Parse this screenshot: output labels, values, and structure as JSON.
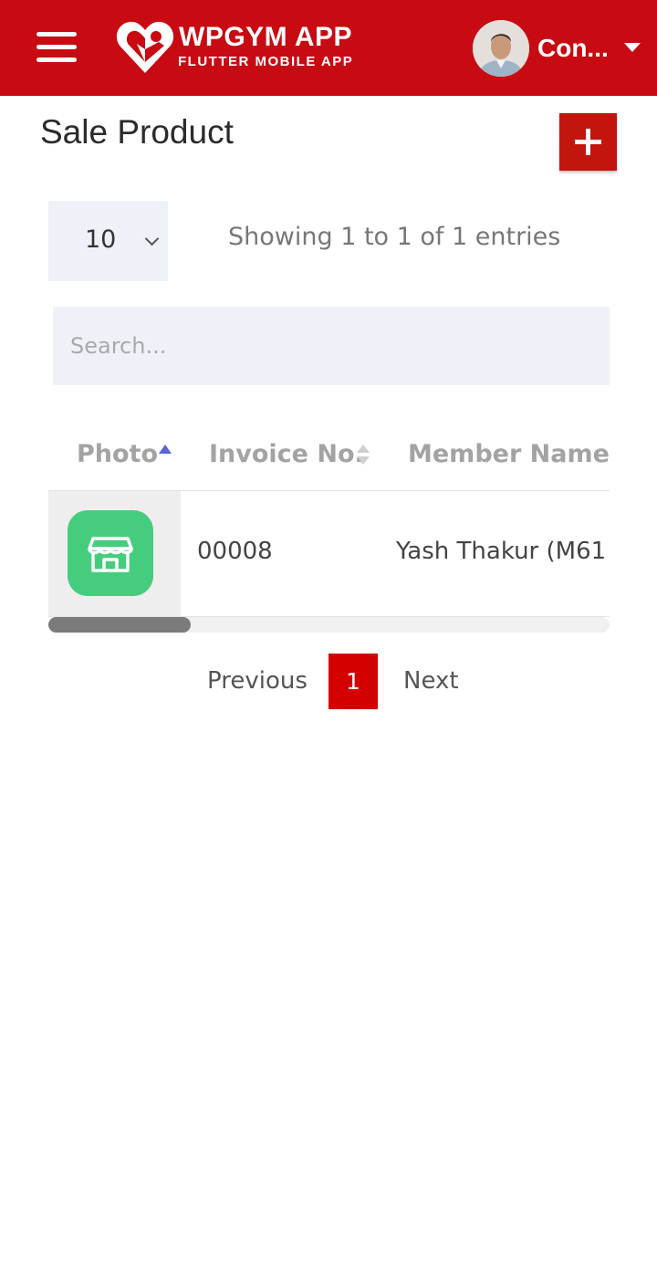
{
  "appbar": {
    "brand_title": "WPGYM APP",
    "brand_subtitle": "FLUTTER MOBILE APP",
    "user_name": "Con...",
    "icons": [
      "hamburger-menu-icon",
      "wpgym-logo",
      "dropdown-caret-icon"
    ]
  },
  "page": {
    "title": "Sale Product",
    "add_button_icon": "plus-icon"
  },
  "table_controls": {
    "page_length": "10",
    "info": "Showing 1 to 1 of 1 entries",
    "search_placeholder": "Search..."
  },
  "table": {
    "columns": [
      "Photo",
      "Invoice No.",
      "Member Name"
    ],
    "sorted_column": "Photo",
    "rows": [
      {
        "photo_icon": "store-icon",
        "invoice_no": "00008",
        "member_name": "Yash Thakur (M61"
      }
    ]
  },
  "pagination": {
    "previous_label": "Previous",
    "current_page": "1",
    "next_label": "Next"
  },
  "colors": {
    "brand_red": "#c80a12",
    "photo_green": "#46cc7d",
    "active_sort": "#5a64d8"
  }
}
